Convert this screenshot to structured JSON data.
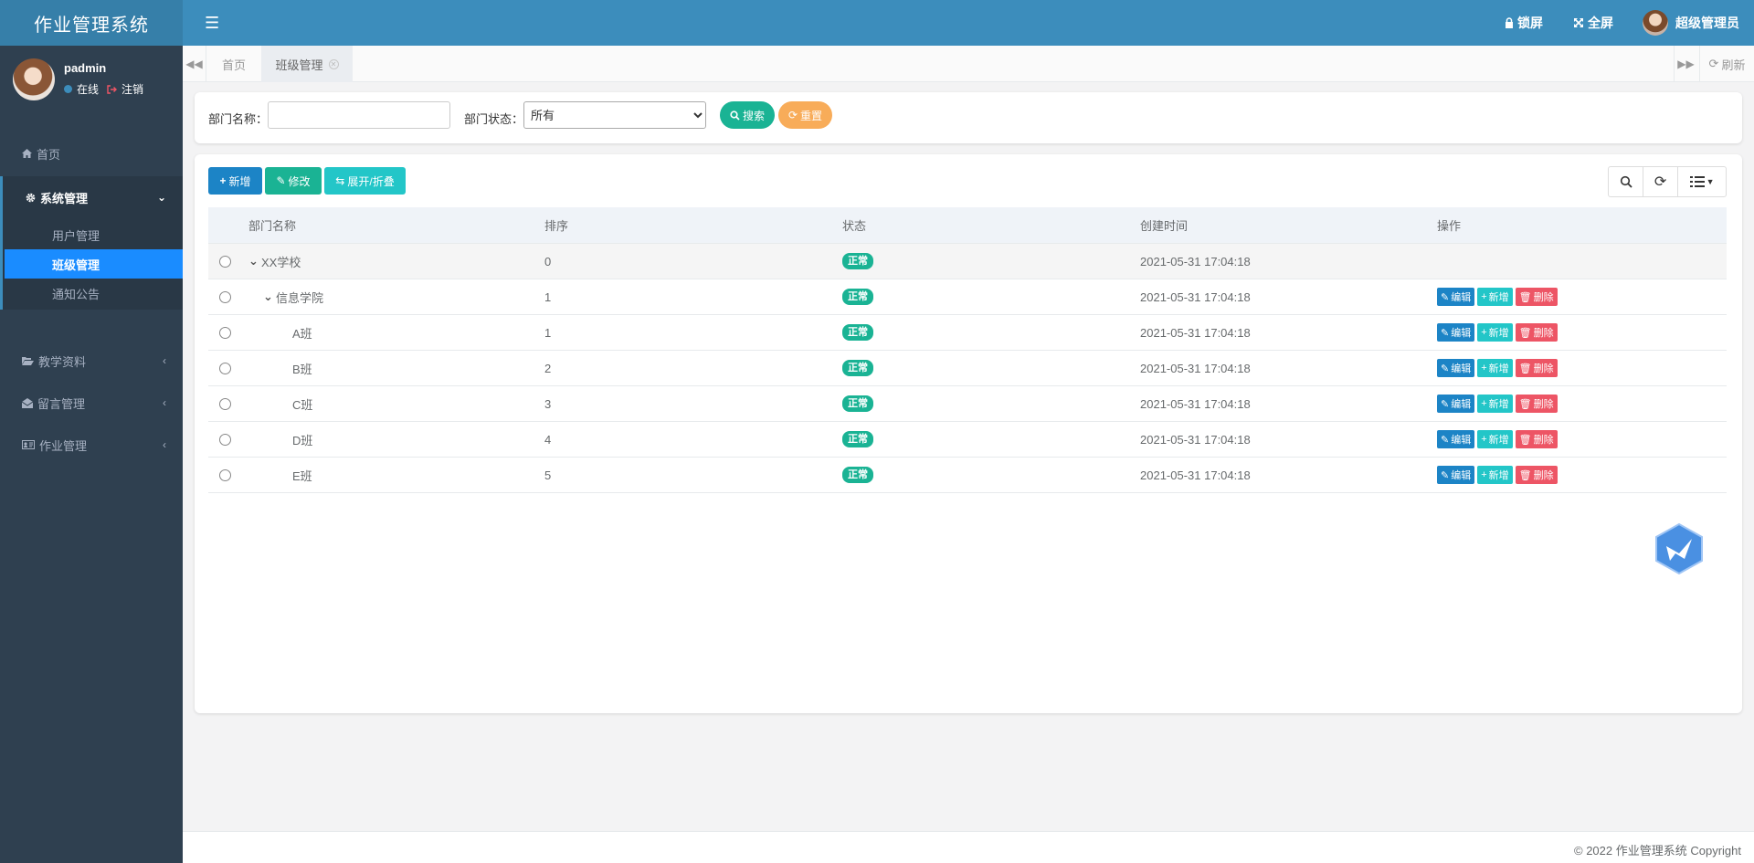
{
  "app": {
    "title": "作业管理系统"
  },
  "header": {
    "lock": "锁屏",
    "fullscreen": "全屏",
    "user": "超级管理员"
  },
  "sidebar": {
    "username": "padmin",
    "online": "在线",
    "logout": "注销",
    "home": "首页",
    "system": "系统管理",
    "sub": [
      "用户管理",
      "班级管理",
      "通知公告"
    ],
    "teach": "教学资料",
    "message": "留言管理",
    "homework": "作业管理"
  },
  "tabs": {
    "home": "首页",
    "active": "班级管理",
    "refresh": "刷新"
  },
  "search": {
    "name_label": "部门名称：",
    "name_value": "",
    "status_label": "部门状态：",
    "status_value": "所有",
    "search_btn": "搜索",
    "reset_btn": "重置"
  },
  "toolbar": {
    "add": "新增",
    "edit": "修改",
    "toggle": "展开/折叠"
  },
  "table": {
    "headers": [
      "部门名称",
      "排序",
      "状态",
      "创建时间",
      "操作"
    ],
    "rows": [
      {
        "name": "XX学校",
        "sort": "0",
        "status": "正常",
        "time": "2021-05-31 17:04:18",
        "ops": false
      },
      {
        "name": "信息学院",
        "sort": "1",
        "status": "正常",
        "time": "2021-05-31 17:04:18",
        "ops": true
      },
      {
        "name": "A班",
        "sort": "1",
        "status": "正常",
        "time": "2021-05-31 17:04:18",
        "ops": true
      },
      {
        "name": "B班",
        "sort": "2",
        "status": "正常",
        "time": "2021-05-31 17:04:18",
        "ops": true
      },
      {
        "name": "C班",
        "sort": "3",
        "status": "正常",
        "time": "2021-05-31 17:04:18",
        "ops": true
      },
      {
        "name": "D班",
        "sort": "4",
        "status": "正常",
        "time": "2021-05-31 17:04:18",
        "ops": true
      },
      {
        "name": "E班",
        "sort": "5",
        "status": "正常",
        "time": "2021-05-31 17:04:18",
        "ops": true
      }
    ],
    "op_edit": "编辑",
    "op_add": "新增",
    "op_delete": "删除"
  },
  "footer": {
    "copyright": "© 2022 作业管理系统 Copyright"
  },
  "colors": {
    "header": "#3c8dbc",
    "sidebar": "#2f4050",
    "primary": "#1c84c6",
    "success": "#1ab394",
    "info": "#23c6c8",
    "warning": "#f8ac59",
    "danger": "#ed5565"
  }
}
